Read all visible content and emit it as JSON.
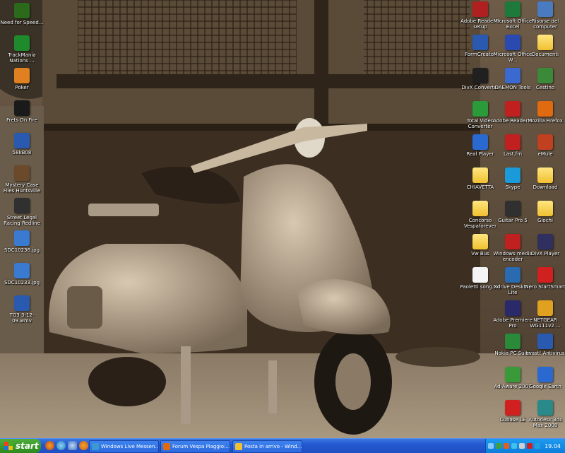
{
  "desktop": {
    "left_column": [
      {
        "label": "Need for Speed...",
        "icon": "game-icon",
        "color": "#2a6a1a"
      },
      {
        "label": "TrackMania Nations ...",
        "icon": "game-icon",
        "color": "#1e8a2c"
      },
      {
        "label": "Poker",
        "icon": "cards-icon",
        "color": "#e08020"
      },
      {
        "label": "Frets On Fire",
        "icon": "guitar-icon",
        "color": "#1a1a1a"
      },
      {
        "label": "58kB08",
        "icon": "app-icon",
        "color": "#2a5ab0"
      },
      {
        "label": "Mystery Case Files Huntsville",
        "icon": "game-icon",
        "color": "#6a4a2a"
      },
      {
        "label": "Street Legal Racing Redline",
        "icon": "car-icon",
        "color": "#303030"
      },
      {
        "label": "SDC10236.jpg",
        "icon": "image-file-icon",
        "color": "#3a7ad0"
      },
      {
        "label": "SDC10233.jpg",
        "icon": "image-file-icon",
        "color": "#3a7ad0"
      },
      {
        "label": "TG3 3-12-09.wmv",
        "icon": "video-file-icon",
        "color": "#2a5ab0"
      }
    ],
    "right_columns": [
      {
        "label": "Adobe Reader 8 setup",
        "icon": "installer-icon",
        "color": "#b02020"
      },
      {
        "label": "Microsoft Office Excel",
        "icon": "excel-icon",
        "color": "#1e7a3a"
      },
      {
        "label": "Risorse del computer",
        "icon": "computer-icon",
        "color": "#4a7ac0"
      },
      {
        "label": "FormCreator",
        "icon": "app-icon",
        "color": "#2a5ab0"
      },
      {
        "label": "Microsoft Office W...",
        "icon": "word-icon",
        "color": "#2a4ab0"
      },
      {
        "label": "Documenti",
        "icon": "folder-icon",
        "color": "#f0c030"
      },
      {
        "label": "DivX Converter",
        "icon": "divx-icon",
        "color": "#202020"
      },
      {
        "label": "DAEMON Tools",
        "icon": "daemon-icon",
        "color": "#3a6ad0"
      },
      {
        "label": "Cestino",
        "icon": "recycle-bin-icon",
        "color": "#3a8a3a"
      },
      {
        "label": "Total Video Converter",
        "icon": "video-icon",
        "color": "#2a9a3a"
      },
      {
        "label": "Adobe Reader 8",
        "icon": "pdf-icon",
        "color": "#c02020"
      },
      {
        "label": "Mozilla Firefox",
        "icon": "firefox-icon",
        "color": "#e06a10"
      },
      {
        "label": "Real Player",
        "icon": "realplayer-icon",
        "color": "#2a6ad0"
      },
      {
        "label": "Last.fm",
        "icon": "lastfm-icon",
        "color": "#c02020"
      },
      {
        "label": "eMule",
        "icon": "emule-icon",
        "color": "#c04020"
      },
      {
        "label": "CHIAVETTA",
        "icon": "folder-icon",
        "color": "#f0c030"
      },
      {
        "label": "Skype",
        "icon": "skype-icon",
        "color": "#1a9ad8"
      },
      {
        "label": "Download",
        "icon": "folder-icon",
        "color": "#f0c030"
      },
      {
        "label": "Concorso Vespaforever",
        "icon": "folder-icon",
        "color": "#f0c030"
      },
      {
        "label": "Guitar Pro 5",
        "icon": "guitar-icon",
        "color": "#303030"
      },
      {
        "label": "Giochi",
        "icon": "folder-icon",
        "color": "#f0c030"
      },
      {
        "label": "Vw Bus",
        "icon": "folder-icon",
        "color": "#f0c030"
      },
      {
        "label": "Windows media encoder",
        "icon": "media-icon",
        "color": "#c02020"
      },
      {
        "label": "DivX Player",
        "icon": "divx-icon",
        "color": "#303060"
      },
      {
        "label": "Paoletti song.txt",
        "icon": "text-file-icon",
        "color": "#f4f4f4"
      },
      {
        "label": "Xdrive Desktop Lite",
        "icon": "drive-icon",
        "color": "#2a6ab0"
      },
      {
        "label": "Nero StartSmart",
        "icon": "nero-icon",
        "color": "#d02020"
      },
      {
        "label": "",
        "icon": "",
        "color": ""
      },
      {
        "label": "Adobe Premiere Pro",
        "icon": "premiere-icon",
        "color": "#2a2a6a"
      },
      {
        "label": "NETGEAR WG111v2 ...",
        "icon": "network-icon",
        "color": "#e0a020"
      },
      {
        "label": "",
        "icon": "",
        "color": ""
      },
      {
        "label": "Nokia PC Suite",
        "icon": "nokia-icon",
        "color": "#2a8a3a"
      },
      {
        "label": "avast! Antivirus",
        "icon": "avast-icon",
        "color": "#2a5ab0"
      },
      {
        "label": "",
        "icon": "",
        "color": ""
      },
      {
        "label": "Ad-Aware 2007",
        "icon": "adaware-icon",
        "color": "#3a9a3a"
      },
      {
        "label": "Google Earth",
        "icon": "globe-icon",
        "color": "#2a6ad0"
      },
      {
        "label": "",
        "icon": "",
        "color": ""
      },
      {
        "label": "Cubase LE",
        "icon": "cubase-icon",
        "color": "#d02020"
      },
      {
        "label": "Autodesk 3ds Max 2008",
        "icon": "3ds-icon",
        "color": "#2a8a8a"
      }
    ]
  },
  "taskbar": {
    "start_label": "start",
    "tasks": [
      {
        "label": "Windows Live Messen...",
        "color": "#3a9ad0"
      },
      {
        "label": "Forum Vespa Piaggio:...",
        "color": "#e06a10"
      },
      {
        "label": "Posta in arrivo - Wind...",
        "color": "#f0c030"
      }
    ],
    "clock": "19.04"
  }
}
